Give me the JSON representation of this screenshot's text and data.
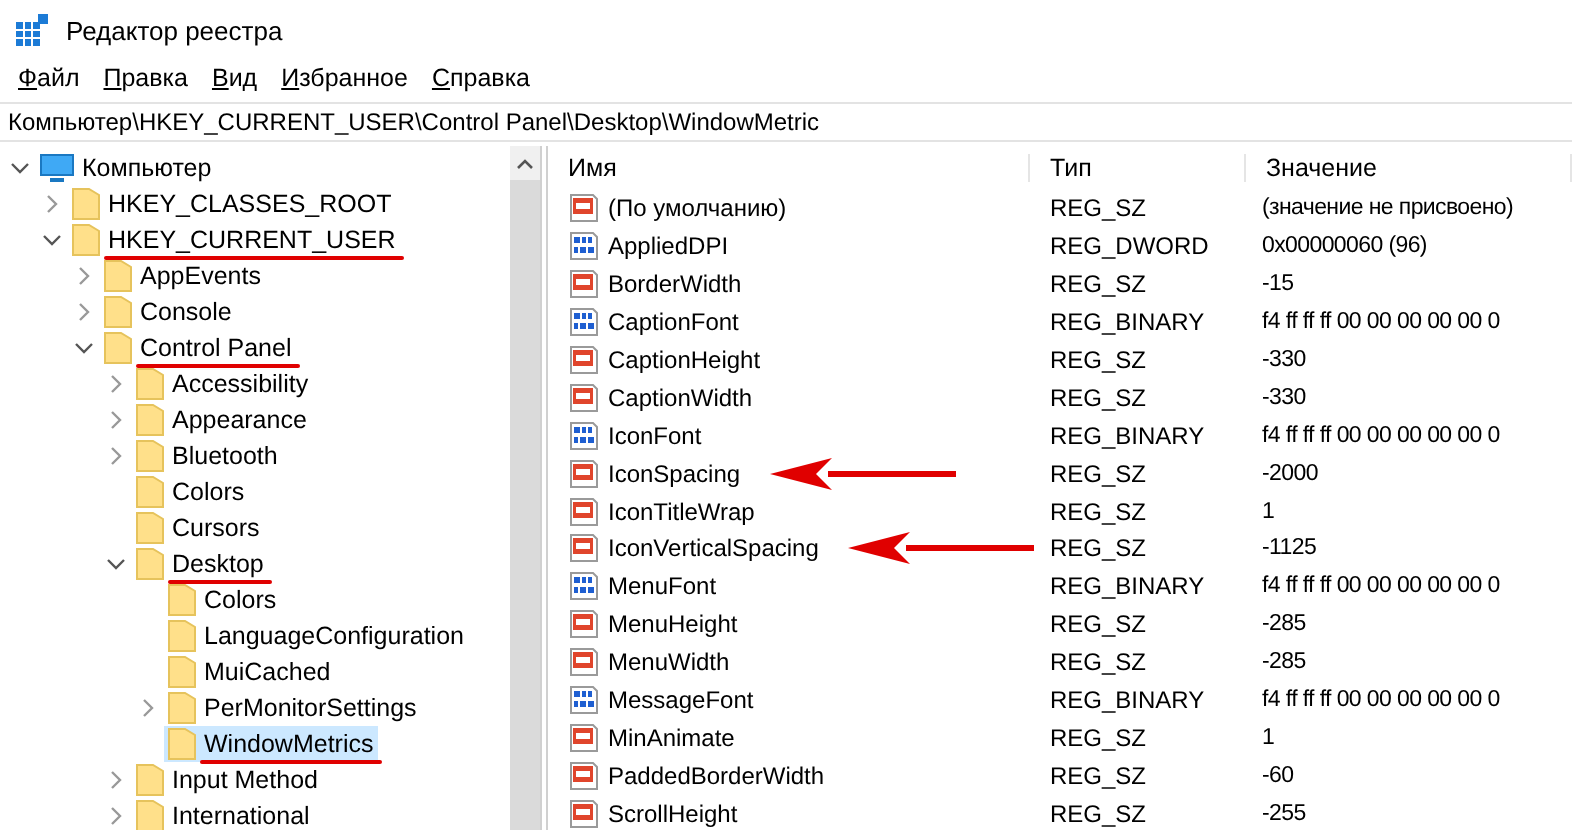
{
  "window": {
    "title": "Редактор реестра"
  },
  "menu": [
    {
      "label": "Файл"
    },
    {
      "label": "Правка"
    },
    {
      "label": "Вид"
    },
    {
      "label": "Избранное"
    },
    {
      "label": "Справка"
    }
  ],
  "address": "Компьютер\\HKEY_CURRENT_USER\\Control Panel\\Desktop\\WindowMetric",
  "tree": [
    {
      "label": "Компьютер",
      "kind": "computer",
      "expanded": true,
      "selected": false,
      "marked": false,
      "children": [
        {
          "label": "HKEY_CLASSES_ROOT",
          "kind": "branch",
          "expanded": false,
          "selected": false,
          "marked": false
        },
        {
          "label": "HKEY_CURRENT_USER",
          "kind": "branch",
          "expanded": true,
          "selected": false,
          "marked": true,
          "children": [
            {
              "label": "AppEvents",
              "kind": "branch",
              "expanded": false,
              "selected": false,
              "marked": false
            },
            {
              "label": "Console",
              "kind": "branch",
              "expanded": false,
              "selected": false,
              "marked": false
            },
            {
              "label": "Control Panel",
              "kind": "branch",
              "expanded": true,
              "selected": false,
              "marked": true,
              "children": [
                {
                  "label": "Accessibility",
                  "kind": "branch",
                  "expanded": false,
                  "selected": false,
                  "marked": false
                },
                {
                  "label": "Appearance",
                  "kind": "branch",
                  "expanded": false,
                  "selected": false,
                  "marked": false
                },
                {
                  "label": "Bluetooth",
                  "kind": "branch",
                  "expanded": false,
                  "selected": false,
                  "marked": false
                },
                {
                  "label": "Colors",
                  "kind": "leaf",
                  "selected": false,
                  "marked": false
                },
                {
                  "label": "Cursors",
                  "kind": "leaf",
                  "selected": false,
                  "marked": false
                },
                {
                  "label": "Desktop",
                  "kind": "branch",
                  "expanded": true,
                  "selected": false,
                  "marked": true,
                  "children": [
                    {
                      "label": "Colors",
                      "kind": "leaf",
                      "selected": false,
                      "marked": false
                    },
                    {
                      "label": "LanguageConfiguration",
                      "kind": "leaf",
                      "selected": false,
                      "marked": false
                    },
                    {
                      "label": "MuiCached",
                      "kind": "leaf",
                      "selected": false,
                      "marked": false
                    },
                    {
                      "label": "PerMonitorSettings",
                      "kind": "branch",
                      "expanded": false,
                      "selected": false,
                      "marked": false
                    },
                    {
                      "label": "WindowMetrics",
                      "kind": "leaf",
                      "selected": true,
                      "marked": true
                    }
                  ]
                },
                {
                  "label": "Input Method",
                  "kind": "branch",
                  "expanded": false,
                  "selected": false,
                  "marked": false
                },
                {
                  "label": "International",
                  "kind": "branch",
                  "expanded": false,
                  "selected": false,
                  "marked": false
                }
              ]
            }
          ]
        }
      ]
    }
  ],
  "table": {
    "columns": [
      "Имя",
      "Тип",
      "Значение"
    ],
    "rows": [
      {
        "kind": "string",
        "name": "(По умолчанию)",
        "type": "REG_SZ",
        "value": "(значение не присвоено)",
        "pointed": false
      },
      {
        "kind": "binary",
        "name": "AppliedDPI",
        "type": "REG_DWORD",
        "value": "0x00000060 (96)",
        "pointed": false
      },
      {
        "kind": "string",
        "name": "BorderWidth",
        "type": "REG_SZ",
        "value": "-15",
        "pointed": false
      },
      {
        "kind": "binary",
        "name": "CaptionFont",
        "type": "REG_BINARY",
        "value": "f4 ff ff ff 00 00 00 00 00 0",
        "pointed": false
      },
      {
        "kind": "string",
        "name": "CaptionHeight",
        "type": "REG_SZ",
        "value": "-330",
        "pointed": false
      },
      {
        "kind": "string",
        "name": "CaptionWidth",
        "type": "REG_SZ",
        "value": "-330",
        "pointed": false
      },
      {
        "kind": "binary",
        "name": "IconFont",
        "type": "REG_BINARY",
        "value": "f4 ff ff ff 00 00 00 00 00 0",
        "pointed": false
      },
      {
        "kind": "string",
        "name": "IconSpacing",
        "type": "REG_SZ",
        "value": "-2000",
        "pointed": true
      },
      {
        "kind": "string",
        "name": "IconTitleWrap",
        "type": "REG_SZ",
        "value": "1",
        "pointed": false
      },
      {
        "kind": "string",
        "name": "IconVerticalSpacing",
        "type": "REG_SZ",
        "value": "-1125",
        "pointed": true
      },
      {
        "kind": "binary",
        "name": "MenuFont",
        "type": "REG_BINARY",
        "value": "f4 ff ff ff 00 00 00 00 00 0",
        "pointed": false
      },
      {
        "kind": "string",
        "name": "MenuHeight",
        "type": "REG_SZ",
        "value": "-285",
        "pointed": false
      },
      {
        "kind": "string",
        "name": "MenuWidth",
        "type": "REG_SZ",
        "value": "-285",
        "pointed": false
      },
      {
        "kind": "binary",
        "name": "MessageFont",
        "type": "REG_BINARY",
        "value": "f4 ff ff ff 00 00 00 00 00 0",
        "pointed": false
      },
      {
        "kind": "string",
        "name": "MinAnimate",
        "type": "REG_SZ",
        "value": "1",
        "pointed": false
      },
      {
        "kind": "string",
        "name": "PaddedBorderWidth",
        "type": "REG_SZ",
        "value": "-60",
        "pointed": false
      },
      {
        "kind": "string",
        "name": "ScrollHeight",
        "type": "REG_SZ",
        "value": "-255",
        "pointed": false
      }
    ]
  }
}
